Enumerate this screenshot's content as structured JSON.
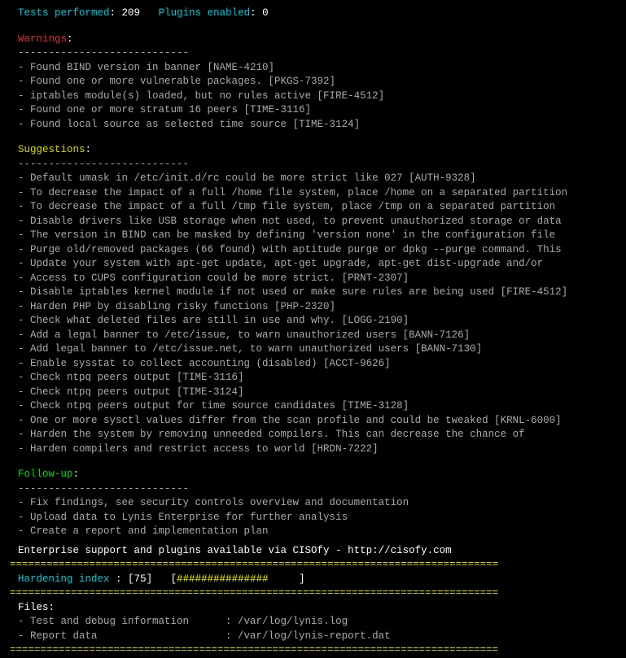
{
  "header": {
    "tests_label": "Tests performed",
    "tests_count": 209,
    "plugins_label": "Plugins enabled",
    "plugins_count": 0
  },
  "dash_line": "----------------------------",
  "eq_line": "================================================================================",
  "warnings": {
    "title": "Warnings",
    "items": [
      "Found BIND version in banner [NAME-4210]",
      "Found one or more vulnerable packages. [PKGS-7392]",
      "iptables module(s) loaded, but no rules active [FIRE-4512]",
      "Found one or more stratum 16 peers [TIME-3116]",
      "Found local source as selected time source [TIME-3124]"
    ]
  },
  "suggestions": {
    "title": "Suggestions",
    "items": [
      "Default umask in /etc/init.d/rc could be more strict like 027 [AUTH-9328]",
      "To decrease the impact of a full /home file system, place /home on a separated partition",
      "To decrease the impact of a full /tmp file system, place /tmp on a separated partition",
      "Disable drivers like USB storage when not used, to prevent unauthorized storage or data",
      "The version in BIND can be masked by defining 'version none' in the configuration file",
      "Purge old/removed packages (66 found) with aptitude purge or dpkg --purge command. This",
      "Update your system with apt-get update, apt-get upgrade, apt-get dist-upgrade and/or",
      "Access to CUPS configuration could be more strict. [PRNT-2307]",
      "Disable iptables kernel module if not used or make sure rules are being used [FIRE-4512]",
      "Harden PHP by disabling risky functions [PHP-2320]",
      "Check what deleted files are still in use and why. [LOGG-2190]",
      "Add a legal banner to /etc/issue, to warn unauthorized users [BANN-7126]",
      "Add legal banner to /etc/issue.net, to warn unauthorized users [BANN-7130]",
      "Enable sysstat to collect accounting (disabled) [ACCT-9626]",
      "Check ntpq peers output [TIME-3116]",
      "Check ntpq peers output [TIME-3124]",
      "Check ntpq peers output for time source candidates [TIME-3128]",
      "One or more sysctl values differ from the scan profile and could be tweaked [KRNL-6000]",
      "Harden the system by removing unneeded compilers. This can decrease the chance of",
      "Harden compilers and restrict access to world [HRDN-7222]"
    ]
  },
  "followup": {
    "title": "Follow-up",
    "items": [
      "Fix findings, see security controls overview and documentation",
      "Upload data to Lynis Enterprise for further analysis",
      "Create a report and implementation plan"
    ]
  },
  "enterprise": "Enterprise support and plugins available via CISOfy - http://cisofy.com",
  "hardening": {
    "label": "Hardening index",
    "value": 75,
    "bar_filled": "###############",
    "bar_empty": "     "
  },
  "files": {
    "title": "Files",
    "items": [
      {
        "label": "Test and debug information",
        "value": "/var/log/lynis.log"
      },
      {
        "label": "Report data",
        "value": "/var/log/lynis-report.dat"
      }
    ]
  }
}
